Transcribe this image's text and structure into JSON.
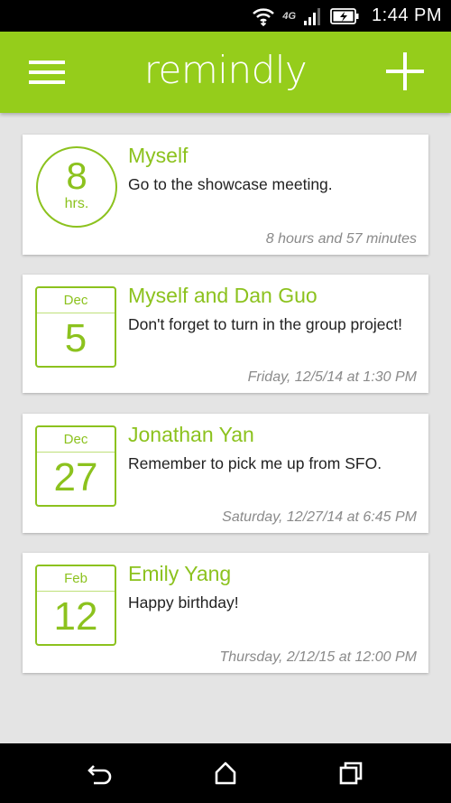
{
  "status_bar": {
    "network": "4G",
    "time": "1:44 PM",
    "icons": [
      "wifi-icon",
      "signal-icon",
      "battery-charging-icon"
    ]
  },
  "app_bar": {
    "title": "remindly",
    "menu_icon": "hamburger-menu-icon",
    "add_icon": "plus-icon"
  },
  "reminders": [
    {
      "badge_type": "countdown",
      "badge_value": "8",
      "badge_unit": "hrs.",
      "name": "Myself",
      "message": "Go to the showcase meeting.",
      "time": "8 hours and 57 minutes"
    },
    {
      "badge_type": "calendar",
      "badge_month": "Dec",
      "badge_day": "5",
      "name": "Myself and Dan Guo",
      "message": "Don't forget to turn in the group project!",
      "time": "Friday, 12/5/14 at 1:30 PM"
    },
    {
      "badge_type": "calendar",
      "badge_month": "Dec",
      "badge_day": "27",
      "name": "Jonathan Yan",
      "message": "Remember to pick me up from SFO.",
      "time": "Saturday, 12/27/14 at 6:45 PM"
    },
    {
      "badge_type": "calendar",
      "badge_month": "Feb",
      "badge_day": "12",
      "name": "Emily Yang",
      "message": "Happy birthday!",
      "time": "Thursday, 2/12/15 at 12:00 PM"
    }
  ],
  "nav_bar": {
    "icons": [
      "back-icon",
      "home-icon",
      "recent-apps-icon"
    ]
  },
  "colors": {
    "accent": "#95cd1b",
    "accent_text": "#8cc21e",
    "background": "#e4e4e4",
    "card": "#ffffff",
    "secondary_text": "#8a8a8a"
  }
}
